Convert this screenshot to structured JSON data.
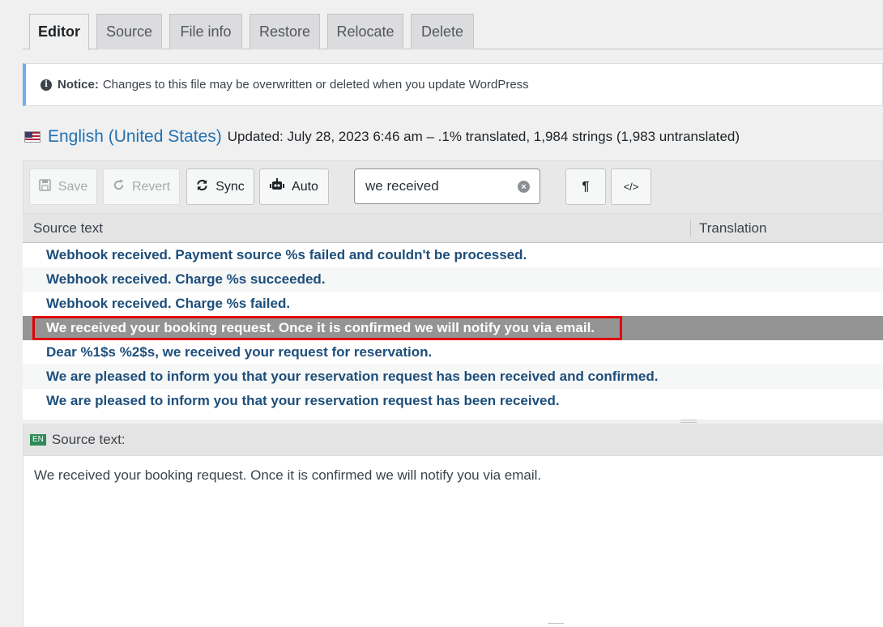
{
  "tabs": [
    {
      "label": "Editor",
      "active": true
    },
    {
      "label": "Source"
    },
    {
      "label": "File info"
    },
    {
      "label": "Restore"
    },
    {
      "label": "Relocate"
    },
    {
      "label": "Delete"
    }
  ],
  "notice": {
    "label": "Notice:",
    "text": "Changes to this file may be overwritten or deleted when you update WordPress"
  },
  "locale": {
    "name": "English (United States)",
    "status": "Updated: July 28, 2023 6:46 am – .1% translated, 1,984 strings (1,983 untranslated)"
  },
  "toolbar": {
    "save_label": "Save",
    "revert_label": "Revert",
    "sync_label": "Sync",
    "auto_label": "Auto",
    "search_value": "we received",
    "pilcrow_label": "¶",
    "code_label": "</>"
  },
  "list": {
    "col_source": "Source text",
    "col_translation": "Translation",
    "rows": [
      "Webhook received. Payment source %s failed and couldn't be processed.",
      "Webhook received. Charge %s succeeded.",
      "Webhook received. Charge %s failed.",
      "We received your booking request. Once it is confirmed we will notify you via email.",
      "Dear %1$s %2$s, we received your request for reservation.",
      "We are pleased to inform you that your reservation request has been received and confirmed.",
      "We are pleased to inform you that your reservation request has been received."
    ],
    "selected_index": 3
  },
  "source_panel": {
    "badge": "EN",
    "heading": "Source text:",
    "text": "We received your booking request. Once it is confirmed we will notify you via email."
  },
  "colors": {
    "accent": "#2271b1",
    "row_text": "#1d4e7a",
    "selected_row": "#949494",
    "highlight": "#e00000"
  }
}
